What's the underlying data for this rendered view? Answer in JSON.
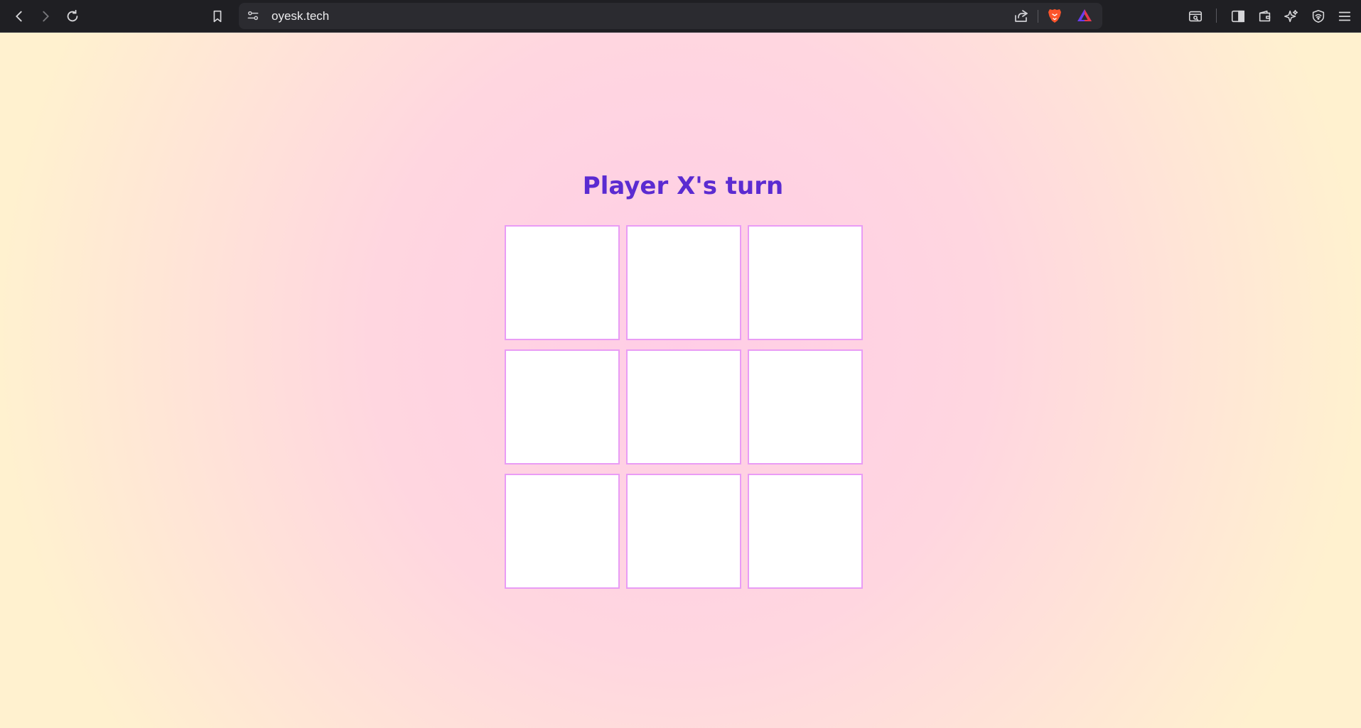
{
  "browser": {
    "url": "oyesk.tech",
    "icons": {
      "back": "chevron-left-icon",
      "forward": "chevron-right-icon",
      "reload": "reload-icon",
      "bookmark": "bookmark-icon",
      "site_settings": "site-settings-icon",
      "share": "share-icon",
      "brave_shields": "brave-lion-icon",
      "rewards": "brave-rewards-icon",
      "search_tabs": "tab-search-icon",
      "sidebar": "sidebar-icon",
      "wallet": "wallet-icon",
      "leo": "leo-sparkle-icon",
      "vpn": "vpn-shield-icon",
      "menu": "hamburger-menu-icon"
    },
    "colors": {
      "toolbar_bg": "#1f1f23",
      "urlbar_bg": "#2b2b30",
      "brave_orange": "#fb542b"
    }
  },
  "game": {
    "status": "Player X's turn",
    "cells": [
      "",
      "",
      "",
      "",
      "",
      "",
      "",
      "",
      ""
    ],
    "colors": {
      "status_text": "#5b2bd1",
      "cell_border": "#e99cf5",
      "cell_bg": "#ffffff",
      "bg_center": "#ffcde6",
      "bg_edge": "#fff1cf"
    }
  }
}
